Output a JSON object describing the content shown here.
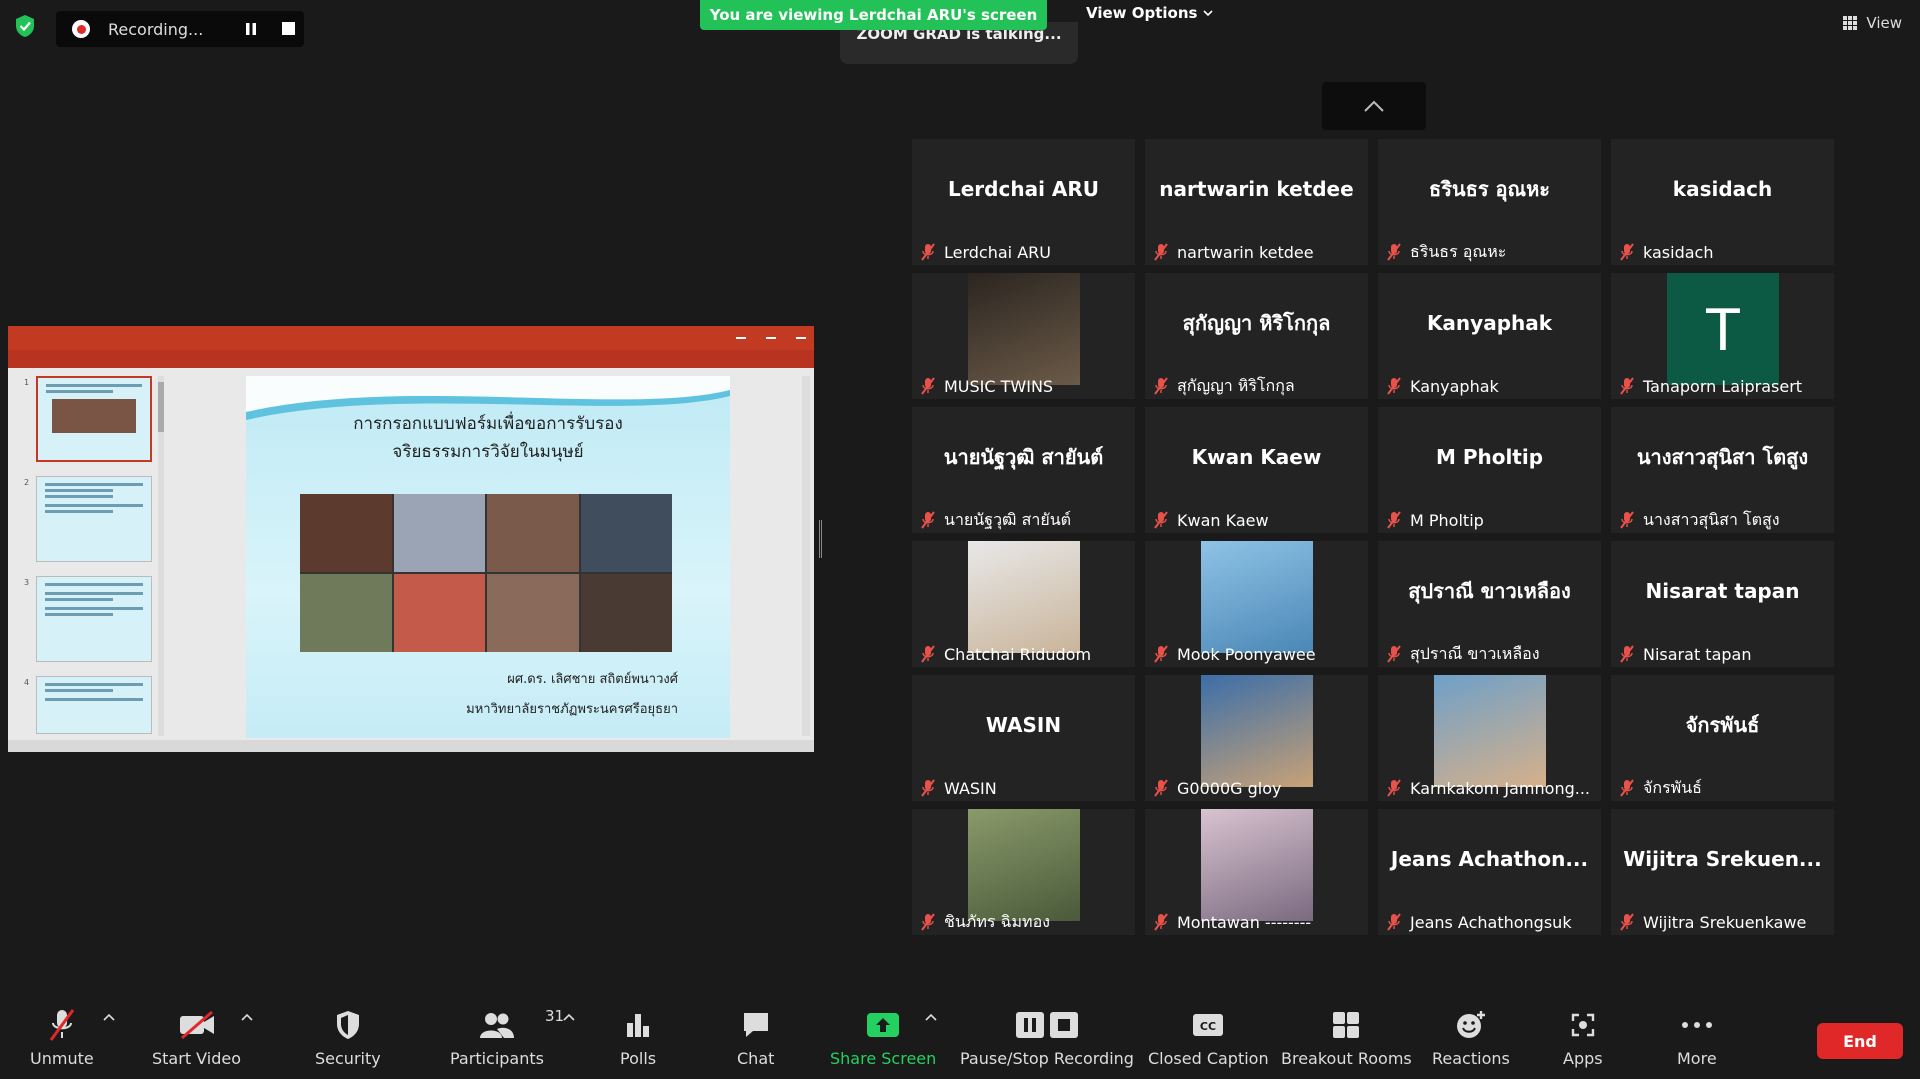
{
  "recording": {
    "label": "Recording..."
  },
  "banner": {
    "viewing": "You are viewing Lerdchai ARU's screen",
    "talking": "ZOOM GRAD is talking...",
    "view_options": "View Options"
  },
  "top_view": "View",
  "ppt": {
    "slide_title_1": "การกรอกแบบฟอร์มเพื่อขอการรับรอง",
    "slide_title_2": "จริยธรรมการวิจัยในมนุษย์",
    "author": "ผศ.ดร. เลิศชาย สถิตย์พนาวงศ์",
    "university": "มหาวิทยาลัยราชภัฏพระนครศรีอยุธยา"
  },
  "participants": [
    {
      "big": "Lerdchai ARU",
      "name": "Lerdchai ARU"
    },
    {
      "big": "nartwarin ketdee",
      "name": "nartwarin ketdee"
    },
    {
      "big": "ธรินธร อุณหะ",
      "name": "ธรินธร อุณหะ"
    },
    {
      "big": "kasidach",
      "name": "kasidach"
    },
    {
      "big": "",
      "name": "MUSIC TWINS"
    },
    {
      "big": "สุกัญญา หิริโกกุล",
      "name": "สุกัญญา หิริโกกุล"
    },
    {
      "big": "Kanyaphak",
      "name": "Kanyaphak"
    },
    {
      "big": "T",
      "name": "Tanaporn Laiprasert"
    },
    {
      "big": "นายนัฐวุฒิ สายันต์",
      "name": "นายนัฐวุฒิ สายันต์"
    },
    {
      "big": "Kwan Kaew",
      "name": "Kwan Kaew"
    },
    {
      "big": "M Pholtip",
      "name": "M Pholtip"
    },
    {
      "big": "นางสาวสุนิสา โตสูง",
      "name": "นางสาวสุนิสา  โตสูง"
    },
    {
      "big": "",
      "name": "Chatchai Ridudom"
    },
    {
      "big": "",
      "name": "Mook Poonyawee"
    },
    {
      "big": "สุปราณี ขาวเหลือง",
      "name": "สุปราณี ขาวเหลือง"
    },
    {
      "big": "Nisarat tapan",
      "name": "Nisarat tapan"
    },
    {
      "big": "WASIN",
      "name": "WASIN"
    },
    {
      "big": "",
      "name": "G0000G gloy"
    },
    {
      "big": "",
      "name": "Karnkakom Jamnong..."
    },
    {
      "big": "จักรพันธ์",
      "name": "จักรพันธ์"
    },
    {
      "big": "",
      "name": "ชินภัทร ฉิมทอง"
    },
    {
      "big": "",
      "name": "Montawan --------"
    },
    {
      "big": "Jeans  Achathon...",
      "name": "Jeans Achathongsuk"
    },
    {
      "big": "Wijitra  Srekuen...",
      "name": "Wijitra Srekuenkawe"
    }
  ],
  "toolbar": {
    "unmute": "Unmute",
    "start_video": "Start Video",
    "security": "Security",
    "participants": "Participants",
    "participants_count": "31",
    "polls": "Polls",
    "chat": "Chat",
    "share_screen": "Share Screen",
    "pause_stop": "Pause/Stop Recording",
    "closed_caption": "Closed Caption",
    "breakout": "Breakout Rooms",
    "reactions": "Reactions",
    "apps": "Apps",
    "more": "More",
    "end": "End"
  },
  "colors": {
    "green": "#23c258",
    "end": "#e02828",
    "tile": "#232323",
    "ppt": "#c23a22"
  }
}
